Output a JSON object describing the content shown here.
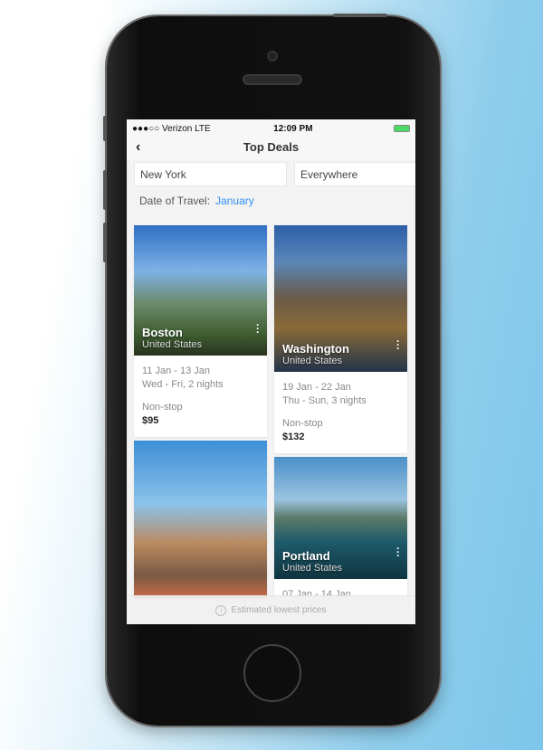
{
  "status": {
    "carrier": "●●●○○ Verizon  LTE",
    "time": "12:09 PM"
  },
  "nav": {
    "back_icon": "chevron-left-icon",
    "title": "Top Deals"
  },
  "search": {
    "origin": "New York",
    "destination": "Everywhere"
  },
  "date": {
    "label": "Date of Travel:",
    "value": "January"
  },
  "accent": "#2f8ef5",
  "deals": [
    {
      "city": "Boston",
      "country": "United States",
      "dates": "11 Jan - 13 Jan",
      "days": "Wed - Fri, 2 nights",
      "type": "Non-stop",
      "price": "$95"
    },
    {
      "city": "Washington",
      "country": "United States",
      "dates": "19 Jan - 22 Jan",
      "days": "Thu - Sun, 3 nights",
      "type": "Non-stop",
      "price": "$132"
    },
    {
      "city": "Portland",
      "country": "United States",
      "dates": "07 Jan - 14 Jan"
    }
  ],
  "footer": {
    "text": "Estimated lowest prices",
    "icon": "info-icon"
  }
}
